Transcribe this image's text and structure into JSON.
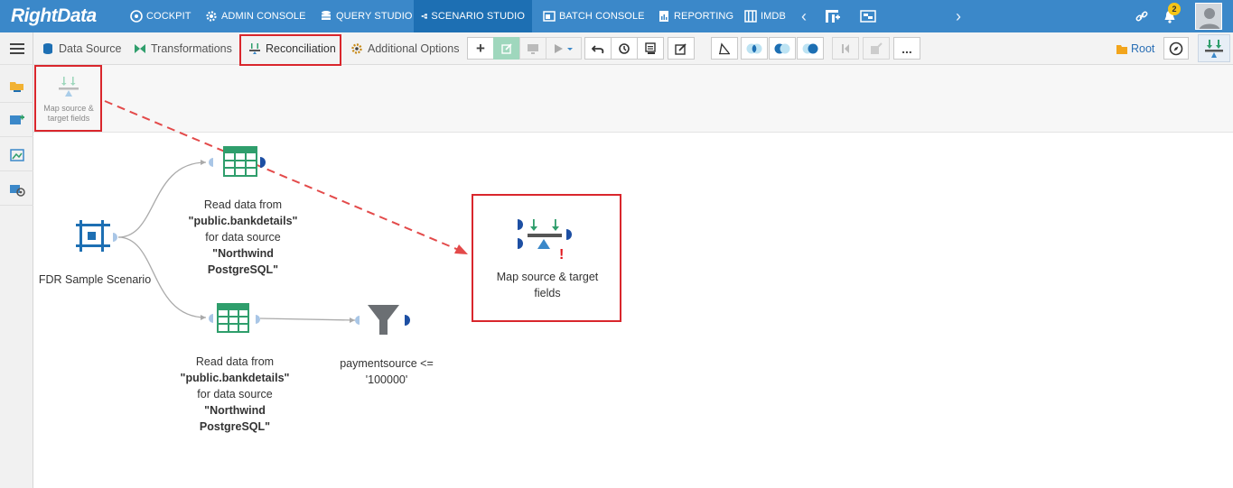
{
  "app": {
    "logo": "RightData"
  },
  "nav": {
    "items": [
      {
        "label": "COCKPIT",
        "icon": "cockpit-icon"
      },
      {
        "label": "ADMIN CONSOLE",
        "icon": "gear-icon"
      },
      {
        "label": "QUERY STUDIO",
        "icon": "database-icon"
      },
      {
        "label": "SCENARIO STUDIO",
        "icon": "scenario-icon",
        "active": true
      },
      {
        "label": "BATCH CONSOLE",
        "icon": "batch-icon"
      },
      {
        "label": "REPORTING",
        "icon": "report-icon"
      },
      {
        "label": "IMDB",
        "icon": "imdb-icon"
      }
    ],
    "notification_count": "2"
  },
  "toolbar": {
    "tabs": [
      {
        "label": "Data Source",
        "icon": "data-source-icon"
      },
      {
        "label": "Transformations",
        "icon": "transformations-icon"
      },
      {
        "label": "Reconciliation",
        "icon": "reconciliation-icon",
        "active": true
      },
      {
        "label": "Additional Options",
        "icon": "settings-icon"
      }
    ],
    "root_label": "Root",
    "more_label": "..."
  },
  "subbar": {
    "item_label": "Map source & target fields"
  },
  "canvas": {
    "scenario_node": {
      "label": "FDR Sample Scenario"
    },
    "read_node_1": {
      "line1": "Read data from",
      "line2": "\"public.bankdetails\"",
      "line3": "for data source",
      "line4": "\"Northwind",
      "line5": "PostgreSQL\""
    },
    "read_node_2": {
      "line1": "Read data from",
      "line2": "\"public.bankdetails\"",
      "line3": "for data source",
      "line4": "\"Northwind",
      "line5": "PostgreSQL\""
    },
    "filter_node": {
      "line1": "paymentsource <=",
      "line2": "'100000'"
    },
    "map_node": {
      "line1": "Map source & target",
      "line2": "fields",
      "warning": "!"
    }
  },
  "colors": {
    "nav_bg": "#3b88c9",
    "nav_active": "#1d6fb3",
    "highlight_red": "#d9262c",
    "table_green": "#2f9e6c",
    "port_blue": "#1d4fa3"
  }
}
